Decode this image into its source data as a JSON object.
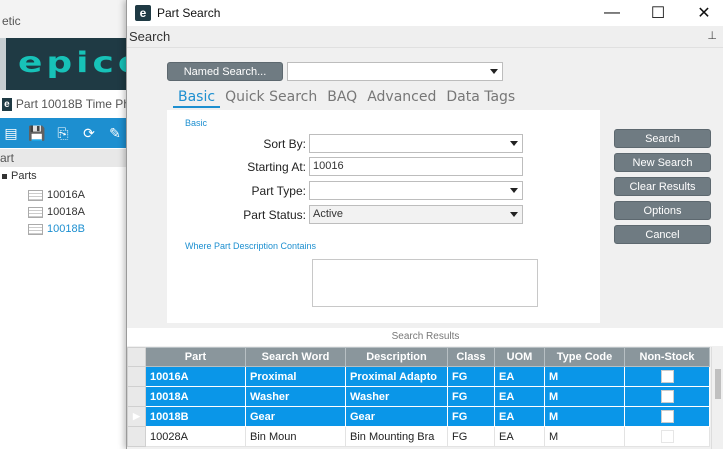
{
  "background_app": {
    "title_fragment": "etic",
    "logo_text": "epico",
    "doc_title": "Part 10018B Time Ph",
    "tree_header": "art",
    "tree_root": "Parts",
    "tree_items": [
      "10016A",
      "10018A",
      "10018B"
    ]
  },
  "dialog": {
    "title": "Part Search",
    "panel_title": "Search",
    "named_search_label": "Named Search...",
    "named_search_value": "",
    "tabs": [
      "Basic",
      "Quick Search",
      "BAQ",
      "Advanced",
      "Data Tags"
    ],
    "section_label": "Basic",
    "fields": {
      "sort_by_label": "Sort By:",
      "sort_by_value": "",
      "starting_at_label": "Starting At:",
      "starting_at_value": "10016",
      "part_type_label": "Part Type:",
      "part_type_value": "",
      "part_status_label": "Part Status:",
      "part_status_value": "Active"
    },
    "description_label": "Where Part Description Contains",
    "buttons": {
      "search": "Search",
      "new_search": "New Search",
      "clear_results": "Clear Results",
      "options": "Options",
      "cancel": "Cancel"
    },
    "results_title": "Search Results",
    "columns": [
      "Part",
      "Search Word",
      "Description",
      "Class",
      "UOM",
      "Type Code",
      "Non-Stock"
    ],
    "rows": [
      {
        "part": "10016A",
        "search_word": "Proximal",
        "description": "Proximal Adapto",
        "class": "FG",
        "uom": "EA",
        "type_code": "M",
        "selected": true,
        "current": false
      },
      {
        "part": "10018A",
        "search_word": "Washer",
        "description": "Washer",
        "class": "FG",
        "uom": "EA",
        "type_code": "M",
        "selected": true,
        "current": false
      },
      {
        "part": "10018B",
        "search_word": "Gear",
        "description": "Gear",
        "class": "FG",
        "uom": "EA",
        "type_code": "M",
        "selected": true,
        "current": true
      },
      {
        "part": "10028A",
        "search_word": "Bin Moun",
        "description": "Bin Mounting Bra",
        "class": "FG",
        "uom": "EA",
        "type_code": "M",
        "selected": false,
        "current": false
      }
    ]
  },
  "colors": {
    "accent": "#1d8fd0",
    "selection": "#0a96e8",
    "button": "#6f7b82",
    "grid_header": "#8a969c",
    "brand_dark": "#1f3a44",
    "logo": "#17c2b8"
  }
}
